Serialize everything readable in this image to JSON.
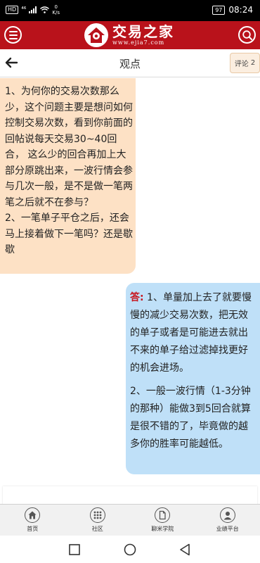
{
  "status_bar": {
    "left_badge": "HD",
    "signal": "⁴⁶",
    "net_speed_value": "0",
    "net_speed_unit": "K/s",
    "battery": "97",
    "time": "08:24"
  },
  "header": {
    "logo_title": "交易之家",
    "logo_url": "www.ejia7.com",
    "icons": {
      "menu": "menu-icon",
      "search": "search-icon",
      "logo": "house-logo-icon"
    },
    "brand_color": "#b9121b"
  },
  "titlebar": {
    "title": "观点",
    "comment_label": "评论",
    "comment_count": "2"
  },
  "question": {
    "paragraphs": [
      "1、为何你的交易次数那么少，这个问题主要是想问如何控制交易次数，看到你前面的回帖说每天交易30~40回合， 这么少的回合再加上大部分原跳出来，一波行情会参与几次一般，是不是做一笔两笔之后就不在参与？",
      "2、一笔单子平仓之后，还会马上接着做下一笔吗？还是歇歇"
    ],
    "bubble_color": "#fde1c5"
  },
  "answer": {
    "label": "答:",
    "paragraphs": [
      " 1、单量加上去了就要慢慢的减少交易次数，把无效的单子或者是可能进去就出不来的单子给过滤掉找更好的机会进场。",
      "2、一般一波行情（1-3分钟的那种）能做3到5回合就算是很不错的了，毕竟做的越多你的胜率可能越低。"
    ],
    "bubble_color": "#bfe0f8"
  },
  "bottom_nav": {
    "items": [
      {
        "label": "首页",
        "icon": "home-icon"
      },
      {
        "label": "社区",
        "icon": "grid-icon"
      },
      {
        "label": "聊米学院",
        "icon": "document-icon"
      },
      {
        "label": "业绩平台",
        "icon": "user-icon"
      }
    ]
  },
  "system_nav": {
    "icons": [
      "square-icon",
      "circle-icon",
      "back-triangle-icon"
    ]
  }
}
